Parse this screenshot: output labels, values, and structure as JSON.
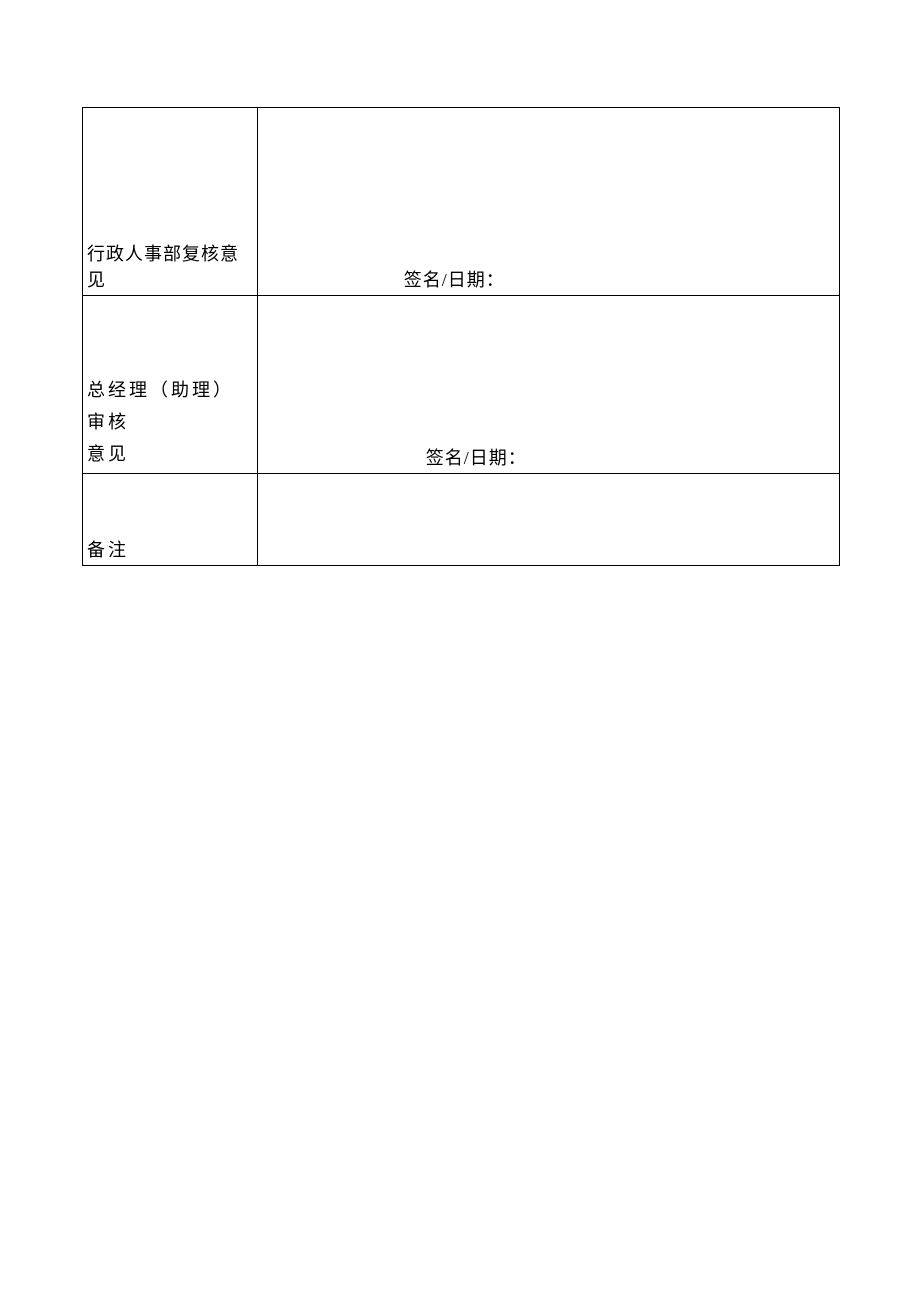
{
  "rows": [
    {
      "label": "行政人事部复核意见",
      "content": "签名/日期："
    },
    {
      "label": "总经理（助理） 审核\n意见",
      "content": "签名/日期："
    },
    {
      "label": "备注",
      "content": ""
    }
  ]
}
